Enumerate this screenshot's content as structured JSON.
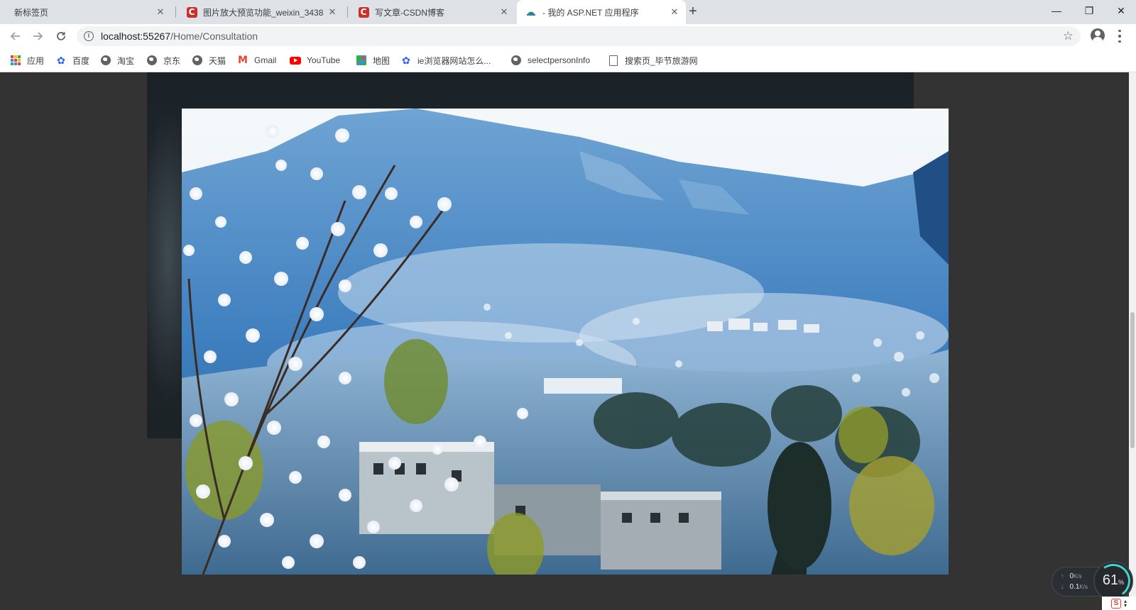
{
  "browser": {
    "tabs": [
      {
        "title": "新标签页",
        "active": false
      },
      {
        "title": "图片放大预览功能_weixin_3438",
        "active": false
      },
      {
        "title": "写文章-CSDN博客",
        "active": false
      },
      {
        "title": "- 我的 ASP.NET 应用程序",
        "active": true
      }
    ],
    "new_tab_label": "+",
    "window_controls": {
      "minimize": "—",
      "restore": "❐",
      "close": "✕"
    },
    "address": {
      "host": "localhost:55267",
      "path": "/Home/Consultation"
    },
    "bookmarks": [
      {
        "label": "应用",
        "icon": "apps-grid-icon"
      },
      {
        "label": "百度",
        "icon": "baidu-paw-icon"
      },
      {
        "label": "淘宝",
        "icon": "globe-icon"
      },
      {
        "label": "京东",
        "icon": "globe-icon"
      },
      {
        "label": "天猫",
        "icon": "globe-icon"
      },
      {
        "label": "Gmail",
        "icon": "gmail-icon"
      },
      {
        "label": "YouTube",
        "icon": "youtube-icon"
      },
      {
        "label": "地图",
        "icon": "maps-icon"
      },
      {
        "label": "ie浏览器网站怎么...",
        "icon": "baidu-paw-icon"
      },
      {
        "label": "selectpersonInfo",
        "icon": "globe-icon"
      },
      {
        "label": "搜索页_毕节旅游网",
        "icon": "document-icon"
      }
    ]
  },
  "colors": {
    "tabstrip": "#dee1e6",
    "page_background": "#333333",
    "accent_gauge": "#3fd4c6"
  },
  "speed_widget": {
    "upload": "0",
    "upload_unit": "K/s",
    "download": "0.1",
    "download_unit": "K/s",
    "cpu_percent": "61",
    "cpu_unit": "%"
  }
}
